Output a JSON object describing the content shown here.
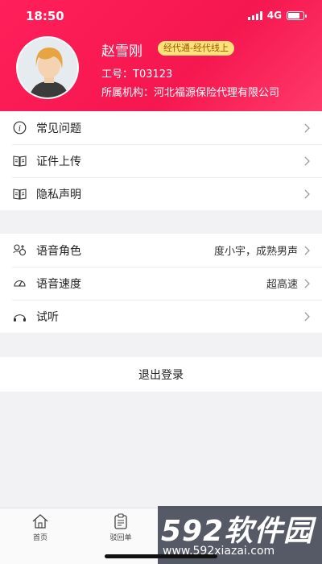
{
  "status_bar": {
    "time": "18:50",
    "network": "4G"
  },
  "profile": {
    "name": "赵雪刚",
    "badge": "经代通-经代线上",
    "employee_id": "工号：T03123",
    "organization": "所属机构：河北福源保险代理有限公司"
  },
  "menu_group_1": [
    {
      "label": "常见问题",
      "icon": "info-icon"
    },
    {
      "label": "证件上传",
      "icon": "book-icon"
    },
    {
      "label": "隐私声明",
      "icon": "book-icon"
    }
  ],
  "menu_group_2": [
    {
      "label": "语音角色",
      "value": "度小宇，成熟男声",
      "icon": "voice-role-icon"
    },
    {
      "label": "语音速度",
      "value": "超高速",
      "icon": "speedometer-icon"
    },
    {
      "label": "试听",
      "value": "",
      "icon": "headphones-icon"
    }
  ],
  "logout_label": "退出登录",
  "tabbar": [
    {
      "label": "首页",
      "icon": "home-icon"
    },
    {
      "label": "驳回单",
      "icon": "clipboard-icon"
    }
  ],
  "watermark": {
    "title": "592软件园",
    "url": "www.592xiazai.com"
  },
  "colors": {
    "header": "#f5174f",
    "badge_bg": "#fde27a",
    "badge_text": "#9a5a00"
  }
}
